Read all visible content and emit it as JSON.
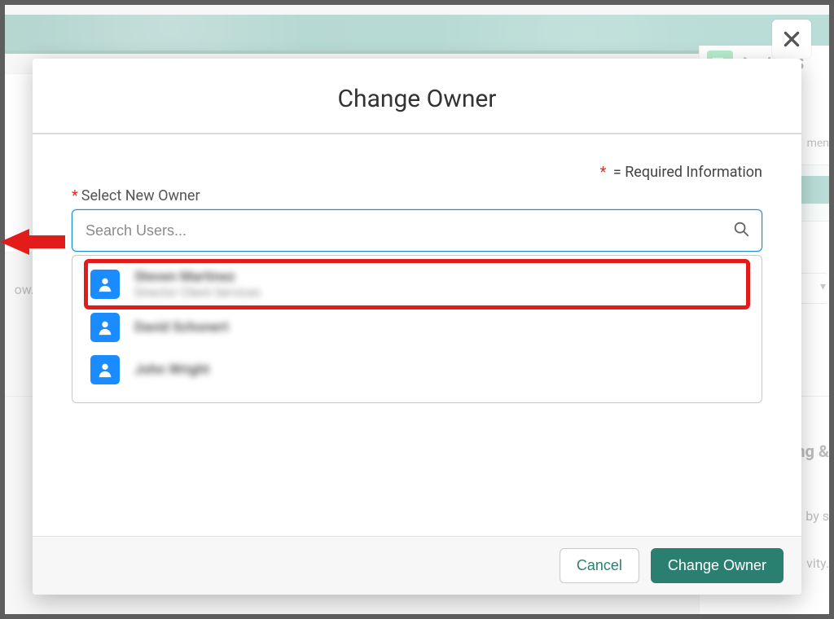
{
  "background": {
    "right_panel_title": "Assign S",
    "left_text": "ow.",
    "right_text1": "ing &",
    "right_text2": "by s",
    "right_text3": "vity.",
    "top_right_fragment": "men"
  },
  "close_label": "Close",
  "modal": {
    "title": "Change Owner",
    "required_note": "= Required Information",
    "field_label": "Select New Owner",
    "search_placeholder": "Search Users...",
    "users": [
      {
        "name": "Steven Martinez",
        "subtitle": "Director Client Services",
        "highlighted": true
      },
      {
        "name": "David Schonert",
        "subtitle": "",
        "highlighted": false
      },
      {
        "name": "John Wright",
        "subtitle": "",
        "highlighted": false
      }
    ],
    "footer": {
      "cancel": "Cancel",
      "confirm": "Change Owner"
    }
  }
}
